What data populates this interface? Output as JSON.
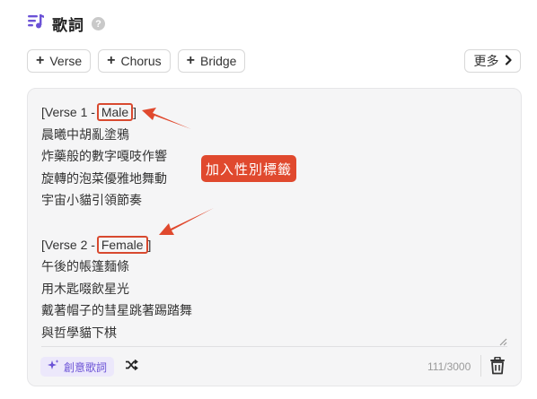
{
  "header": {
    "title": "歌詞",
    "help": "?"
  },
  "tags": [
    {
      "label": "Verse"
    },
    {
      "label": "Chorus"
    },
    {
      "label": "Bridge"
    }
  ],
  "more_label": "更多",
  "lyrics": {
    "v1_prefix": "[Verse 1 -",
    "v1_tag": "Male",
    "v1_lines": [
      "晨曦中胡亂塗鴉",
      "炸藥般的數字嘎吱作響",
      "旋轉的泡菜優雅地舞動",
      "宇宙小貓引領節奏"
    ],
    "v2_prefix": "[Verse 2 -",
    "v2_tag": "Female",
    "v2_lines": [
      "午後的帳篷麵條",
      "用木匙啜飲星光",
      "戴著帽子的彗星跳著踢踏舞",
      "與哲學貓下棋"
    ]
  },
  "footer": {
    "ai_label": "創意歌詞",
    "counter": "111/3000"
  },
  "annotation": {
    "callout": "加入性別標籤"
  },
  "colors": {
    "accent": "#6b52d6",
    "annotation": "#e0492e"
  }
}
